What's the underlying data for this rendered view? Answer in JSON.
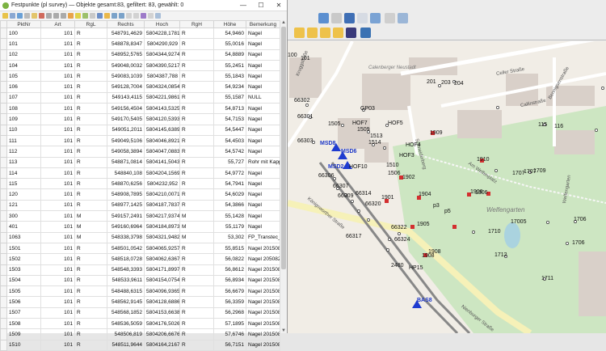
{
  "attr_window": {
    "title": "Festpunkte (pl survey) — Objekte gesamt:83, gefiltert: 83, gewählt: 0",
    "minimize": "—",
    "maximize": "☐",
    "close": "✕",
    "columns": [
      "PktNr",
      "Art",
      "RgL",
      "Rechts",
      "Hoch",
      "RgH",
      "Höhe",
      "Bemerkung"
    ],
    "rows": [
      [
        "100",
        "101",
        "R",
        "548791,4629",
        "5804228,1781",
        "R",
        "54,9460",
        "Nagel"
      ],
      [
        "101",
        "101",
        "R",
        "548878,8347",
        "5804290,929",
        "R",
        "55,0016",
        "Nagel"
      ],
      [
        "102",
        "101",
        "R",
        "548952,5765",
        "5804344,9274",
        "R",
        "54,8889",
        "Nagel"
      ],
      [
        "104",
        "101",
        "R",
        "549048,0032",
        "5804390,5217",
        "R",
        "55,2451",
        "Nagel"
      ],
      [
        "105",
        "101",
        "R",
        "549083,1039",
        "5804387,788",
        "R",
        "55,1843",
        "Nagel"
      ],
      [
        "106",
        "101",
        "R",
        "549128,7004",
        "5804324,0854",
        "R",
        "54,9234",
        "Nagel"
      ],
      [
        "107",
        "101",
        "R",
        "549143,4115",
        "5804221,9861",
        "R",
        "55,1587",
        "NULL"
      ],
      [
        "108",
        "101",
        "R",
        "549156,4504",
        "5804143,5325",
        "R",
        "54,8713",
        "Nagel"
      ],
      [
        "109",
        "101",
        "R",
        "549170,5405",
        "5804120,5393",
        "R",
        "54,7153",
        "Nagel"
      ],
      [
        "110",
        "101",
        "R",
        "549051,2011",
        "5804145,6389",
        "R",
        "54,5447",
        "Nagel"
      ],
      [
        "111",
        "101",
        "R",
        "549049,5106",
        "5804046,8921",
        "R",
        "54,4503",
        "Nagel"
      ],
      [
        "112",
        "101",
        "R",
        "549058,3894",
        "5804047,0883",
        "R",
        "54,5742",
        "Nagel"
      ],
      [
        "113",
        "101",
        "R",
        "548871,0814",
        "5804141,5043",
        "R",
        "55,727",
        "Rohr mit Kappe"
      ],
      [
        "114",
        "101",
        "R",
        "548840,108",
        "5804204,1569",
        "R",
        "54,9772",
        "Nagel"
      ],
      [
        "115",
        "101",
        "R",
        "548870,6256",
        "5804232,952",
        "R",
        "54,7941",
        "Nagel"
      ],
      [
        "120",
        "101",
        "R",
        "548908,7895",
        "5804210,0071",
        "R",
        "54,6029",
        "Nagel"
      ],
      [
        "121",
        "101",
        "R",
        "548977,1425",
        "5804187,7837",
        "R",
        "54,3866",
        "Nagel"
      ],
      [
        "300",
        "101",
        "M",
        "549157,2491",
        "5804217,9374",
        "M",
        "55,1428",
        "Nagel"
      ],
      [
        "401",
        "101",
        "M",
        "549160,6964",
        "5804184,8973",
        "M",
        "55,1179",
        "Nagel"
      ],
      [
        "1063",
        "101",
        "M",
        "548338,3798",
        "5804321,9482",
        "M",
        "53,302",
        "FP_Transtec_kb"
      ],
      [
        "1501",
        "101",
        "R",
        "548501,0542",
        "5804065,9257",
        "R",
        "55,8515",
        "Nagel 20150820..."
      ],
      [
        "1502",
        "101",
        "R",
        "548518,0728",
        "5804062,6367",
        "R",
        "56,0822",
        "Nagel 2050820-..."
      ],
      [
        "1503",
        "101",
        "R",
        "548548,3393",
        "5804171,8997",
        "R",
        "56,8612",
        "Nagel 20150820..."
      ],
      [
        "1504",
        "101",
        "R",
        "548533,9611",
        "5804154,0754",
        "R",
        "56,8934",
        "Nagel 20150820..."
      ],
      [
        "1505",
        "101",
        "R",
        "548488,6315",
        "5804096,9365",
        "R",
        "56,6679",
        "Nagel 20150820..."
      ],
      [
        "1506",
        "101",
        "R",
        "548562,9145",
        "5804128,6886",
        "R",
        "56,3359",
        "Nagel 20150820..."
      ],
      [
        "1507",
        "101",
        "R",
        "548568,1852",
        "5804153,6638",
        "R",
        "56,2968",
        "Nagel 20150820..."
      ],
      [
        "1508",
        "101",
        "R",
        "548536,5059",
        "5804176,5026",
        "R",
        "57,1895",
        "Nagel 20150820..."
      ],
      [
        "1509",
        "101",
        "R",
        "548506,819",
        "5804206,6676",
        "R",
        "57,6746",
        "Nagel 20150820..."
      ],
      [
        "1510",
        "101",
        "R",
        "548511,9644",
        "5804164,2167",
        "R",
        "56,7151",
        "Nagel 20150820..."
      ]
    ]
  },
  "map": {
    "street_names": [
      "Kruggstraße",
      "Celler Straße",
      "Callinstraße",
      "Schneiderberg",
      "Bennigsenstraße",
      "Am Welfenplatz",
      "Nienburger Straße",
      "Königsworther Straße",
      "Welfengarten"
    ],
    "place_names": [
      "Welfengarten",
      "Calenberger Neustadt"
    ],
    "point_labels": [
      {
        "t": "66302",
        "c": "black"
      },
      {
        "t": "66301",
        "c": "black"
      },
      {
        "t": "GP03",
        "c": "black"
      },
      {
        "t": "1505",
        "c": "black"
      },
      {
        "t": "HOF7",
        "c": "black"
      },
      {
        "t": "1509",
        "c": "black"
      },
      {
        "t": "HOF5",
        "c": "black"
      },
      {
        "t": "1513",
        "c": "black"
      },
      {
        "t": "1909",
        "c": "black"
      },
      {
        "t": "66303",
        "c": "black"
      },
      {
        "t": "MSD8",
        "c": "blue"
      },
      {
        "t": "MSD6",
        "c": "blue"
      },
      {
        "t": "1514",
        "c": "black"
      },
      {
        "t": "HOF4",
        "c": "black"
      },
      {
        "t": "MSD2",
        "c": "blue"
      },
      {
        "t": "HOF10",
        "c": "black"
      },
      {
        "t": "HOF3",
        "c": "black"
      },
      {
        "t": "1510",
        "c": "black"
      },
      {
        "t": "1506",
        "c": "black"
      },
      {
        "t": "1902",
        "c": "black"
      },
      {
        "t": "1910",
        "c": "black"
      },
      {
        "t": "66306",
        "c": "black"
      },
      {
        "t": "66307",
        "c": "black"
      },
      {
        "t": "66309",
        "c": "black"
      },
      {
        "t": "66314",
        "c": "black"
      },
      {
        "t": "1901",
        "c": "black"
      },
      {
        "t": "1904",
        "c": "black"
      },
      {
        "t": "1908",
        "c": "black"
      },
      {
        "t": "1709",
        "c": "black"
      },
      {
        "t": "66320",
        "c": "black"
      },
      {
        "t": "1905",
        "c": "black"
      },
      {
        "t": "66322",
        "c": "black"
      },
      {
        "t": "66317",
        "c": "black"
      },
      {
        "t": "66324",
        "c": "black"
      },
      {
        "t": "1908",
        "c": "black"
      },
      {
        "t": "HP15",
        "c": "black"
      },
      {
        "t": "2480",
        "c": "black"
      },
      {
        "t": "BAS8",
        "c": "blue"
      },
      {
        "t": "1707",
        "c": "black"
      },
      {
        "t": "1710",
        "c": "black"
      },
      {
        "t": "17005",
        "c": "black"
      },
      {
        "t": "1712",
        "c": "black"
      },
      {
        "t": "1706",
        "c": "black"
      },
      {
        "t": "1711",
        "c": "black"
      },
      {
        "t": "100",
        "c": "black"
      },
      {
        "t": "101",
        "c": "black"
      },
      {
        "t": "115",
        "c": "black"
      },
      {
        "t": "116",
        "c": "black"
      },
      {
        "t": "201",
        "c": "black"
      },
      {
        "t": "203",
        "c": "black"
      },
      {
        "t": "204",
        "c": "black"
      },
      {
        "t": "p3",
        "c": "black"
      },
      {
        "t": "p5",
        "c": "black"
      },
      {
        "t": "1906",
        "c": "black"
      },
      {
        "t": "1906",
        "c": "black"
      },
      {
        "t": "1707",
        "c": "black"
      },
      {
        "t": "1706",
        "c": "black"
      }
    ],
    "colors": {
      "park": "#cce5c0",
      "road": "#ffffff",
      "major_road": "#f6f1b8",
      "building": "#d9d0c9",
      "rail": "#888888"
    }
  }
}
